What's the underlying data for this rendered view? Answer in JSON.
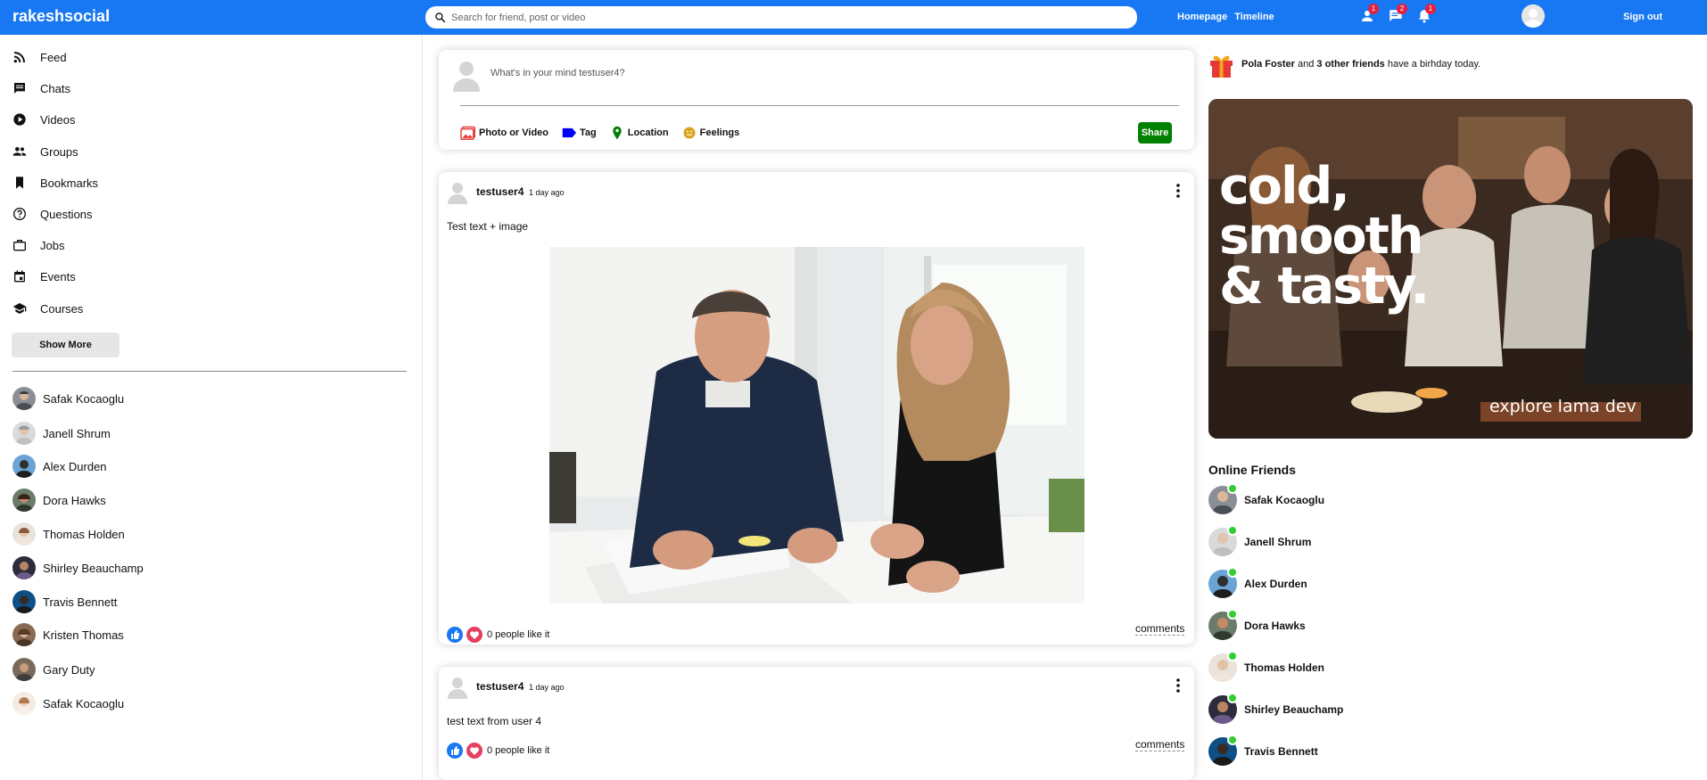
{
  "topbar": {
    "logo": "rakeshsocial",
    "search_placeholder": "Search for friend, post or video",
    "links": [
      "Homepage",
      "Timeline"
    ],
    "icons": [
      {
        "name": "person-icon",
        "badge": "1"
      },
      {
        "name": "chat-icon",
        "badge": "2"
      },
      {
        "name": "notification-icon",
        "badge": "1"
      }
    ],
    "signout": "Sign out",
    "color": "#1877f2"
  },
  "sidebar": {
    "nav": [
      {
        "label": "Feed",
        "icon": "rss-feed-icon"
      },
      {
        "label": "Chats",
        "icon": "chat-icon"
      },
      {
        "label": "Videos",
        "icon": "play-circle-icon"
      },
      {
        "label": "Groups",
        "icon": "group-icon"
      },
      {
        "label": "Bookmarks",
        "icon": "bookmark-icon"
      },
      {
        "label": "Questions",
        "icon": "help-circle-icon"
      },
      {
        "label": "Jobs",
        "icon": "briefcase-icon"
      },
      {
        "label": "Events",
        "icon": "calendar-icon"
      },
      {
        "label": "Courses",
        "icon": "school-icon"
      }
    ],
    "show_more": "Show More",
    "friends": [
      "Safak Kocaoglu",
      "Janell Shrum",
      "Alex Durden",
      "Dora Hawks",
      "Thomas Holden",
      "Shirley Beauchamp",
      "Travis Bennett",
      "Kristen Thomas",
      "Gary Duty",
      "Safak Kocaoglu"
    ]
  },
  "share": {
    "placeholder": "What's in your mind testuser4?",
    "options": [
      {
        "label": "Photo or Video",
        "icon": "photo-icon",
        "color": "#e53935"
      },
      {
        "label": "Tag",
        "icon": "label-icon",
        "color": "#0000ff"
      },
      {
        "label": "Location",
        "icon": "location-pin-icon",
        "color": "#008000"
      },
      {
        "label": "Feelings",
        "icon": "emoji-icon",
        "color": "#daa520"
      }
    ],
    "button": "Share"
  },
  "posts": [
    {
      "user": "testuser4",
      "date": "1 day ago",
      "text": "Test text + image",
      "likes": "0 people like it",
      "comments": "comments"
    },
    {
      "user": "testuser4",
      "date": "1 day ago",
      "text": "test text from user 4",
      "likes": "0 people like it",
      "comments": "comments"
    }
  ],
  "rightbar": {
    "birthday": {
      "name": "Pola Foster",
      "connector": "and",
      "others": "3 other friends",
      "suffix": "have a birhday today."
    },
    "ad": {
      "headline_lines": [
        "cold,",
        "smooth",
        "& tasty."
      ],
      "footer": "explore lama dev"
    },
    "online_title": "Online Friends",
    "online_friends": [
      "Safak Kocaoglu",
      "Janell Shrum",
      "Alex Durden",
      "Dora Hawks",
      "Thomas Holden",
      "Shirley Beauchamp",
      "Travis Bennett"
    ],
    "online_color": "#32cd32"
  }
}
